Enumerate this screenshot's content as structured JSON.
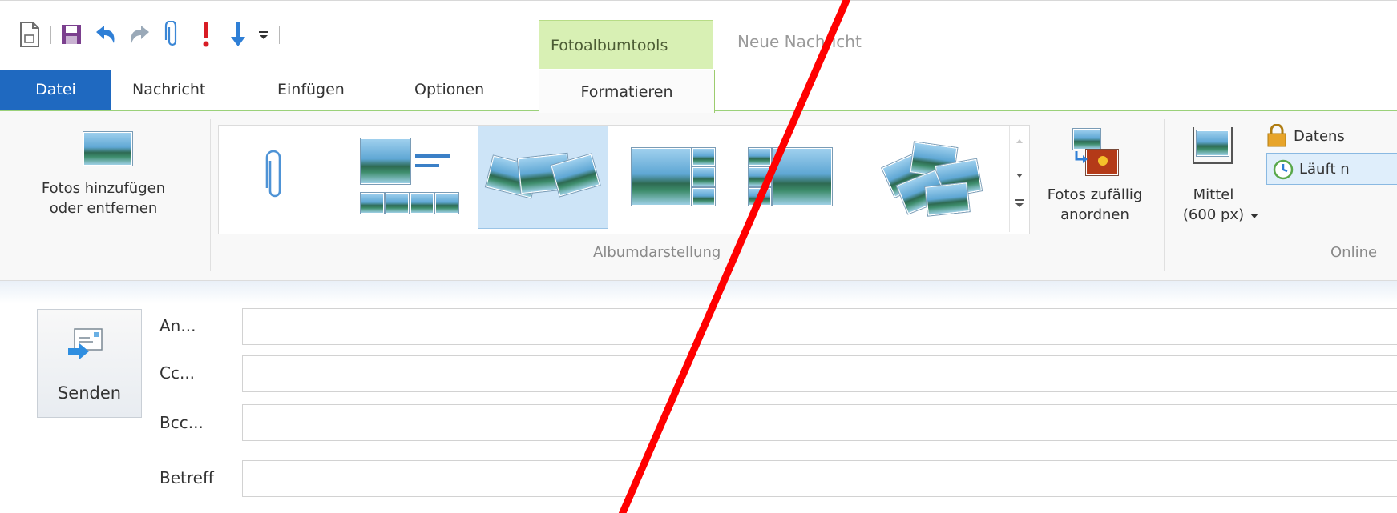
{
  "title_bar": {
    "context_group": "Fotoalbumtools",
    "window_title": "Neue Nachricht"
  },
  "quick_access": [
    {
      "icon": "new-document-icon"
    },
    {
      "icon": "save-icon"
    },
    {
      "icon": "undo-icon"
    },
    {
      "icon": "redo-icon"
    },
    {
      "icon": "attach-icon"
    },
    {
      "icon": "high-priority-icon"
    },
    {
      "icon": "low-priority-icon"
    },
    {
      "icon": "customize-dropdown-icon"
    }
  ],
  "tabs": {
    "file": "Datei",
    "message": "Nachricht",
    "insert": "Einfügen",
    "options": "Optionen",
    "format": "Formatieren"
  },
  "ribbon": {
    "add_photos_label": "Fotos hinzufügen\noder entfernen",
    "album_layout_group": "Albumdarstellung",
    "shuffle_label": "Fotos zufällig\nanordnen",
    "size_label": "Mittel\n(600 px)",
    "security_button": "Datens",
    "expiry_button": "Läuft n",
    "online_group": "Online"
  },
  "compose": {
    "send_label": "Senden",
    "to_label": "An...",
    "cc_label": "Cc...",
    "bcc_label": "Bcc...",
    "subject_label": "Betreff",
    "to_value": "",
    "cc_value": "",
    "bcc_value": "",
    "subject_value": ""
  },
  "colors": {
    "file_tab": "#1f69c0",
    "context_tab": "#d8f0b4",
    "selection": "#cde4f7",
    "overlay_line": "#ff0000"
  }
}
